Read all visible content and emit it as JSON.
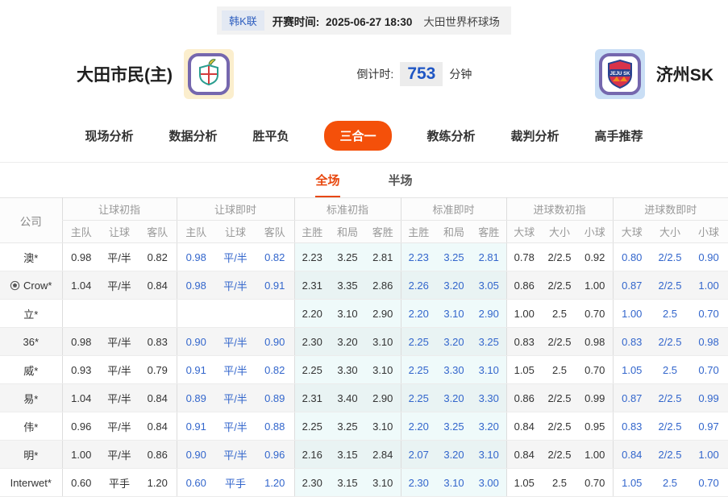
{
  "top_bar": {
    "league": "韩K联",
    "kickoff_label": "开赛时间:",
    "kickoff_time": "2025-06-27 18:30",
    "venue": "大田世界杯球场"
  },
  "match_header": {
    "home_team": "大田市民(主)",
    "away_team": "济州SK",
    "countdown_label": "倒计时:",
    "countdown_value": "753",
    "countdown_unit": "分钟"
  },
  "nav_tabs": [
    {
      "label": "现场分析",
      "active": false
    },
    {
      "label": "数据分析",
      "active": false
    },
    {
      "label": "胜平负",
      "active": false
    },
    {
      "label": "三合一",
      "active": true
    },
    {
      "label": "教练分析",
      "active": false
    },
    {
      "label": "裁判分析",
      "active": false
    },
    {
      "label": "高手推荐",
      "active": false
    }
  ],
  "period_tabs": [
    {
      "label": "全场",
      "active": true
    },
    {
      "label": "半场",
      "active": false
    }
  ],
  "odds_table": {
    "company_header": "公司",
    "groups": [
      {
        "label": "让球初指",
        "cols": [
          "主队",
          "让球",
          "客队"
        ],
        "live": false,
        "tint": false
      },
      {
        "label": "让球即时",
        "cols": [
          "主队",
          "让球",
          "客队"
        ],
        "live": true,
        "tint": false
      },
      {
        "label": "标准初指",
        "cols": [
          "主胜",
          "和局",
          "客胜"
        ],
        "live": false,
        "tint": true
      },
      {
        "label": "标准即时",
        "cols": [
          "主胜",
          "和局",
          "客胜"
        ],
        "live": true,
        "tint": true
      },
      {
        "label": "进球数初指",
        "cols": [
          "大球",
          "大小",
          "小球"
        ],
        "live": false,
        "tint": false
      },
      {
        "label": "进球数即时",
        "cols": [
          "大球",
          "大小",
          "小球"
        ],
        "live": true,
        "tint": false
      }
    ],
    "rows": [
      {
        "company": "澳*",
        "icon": false,
        "cells": [
          [
            "0.98",
            "平/半",
            "0.82"
          ],
          [
            "0.98",
            "平/半",
            "0.82"
          ],
          [
            "2.23",
            "3.25",
            "2.81"
          ],
          [
            "2.23",
            "3.25",
            "2.81"
          ],
          [
            "0.78",
            "2/2.5",
            "0.92"
          ],
          [
            "0.80",
            "2/2.5",
            "0.90"
          ]
        ]
      },
      {
        "company": "Crow*",
        "icon": true,
        "cells": [
          [
            "1.04",
            "平/半",
            "0.84"
          ],
          [
            "0.98",
            "平/半",
            "0.91"
          ],
          [
            "2.31",
            "3.35",
            "2.86"
          ],
          [
            "2.26",
            "3.20",
            "3.05"
          ],
          [
            "0.86",
            "2/2.5",
            "1.00"
          ],
          [
            "0.87",
            "2/2.5",
            "1.00"
          ]
        ]
      },
      {
        "company": "立*",
        "icon": false,
        "cells": [
          [
            "",
            "",
            ""
          ],
          [
            "",
            "",
            ""
          ],
          [
            "2.20",
            "3.10",
            "2.90"
          ],
          [
            "2.20",
            "3.10",
            "2.90"
          ],
          [
            "1.00",
            "2.5",
            "0.70"
          ],
          [
            "1.00",
            "2.5",
            "0.70"
          ]
        ]
      },
      {
        "company": "36*",
        "icon": false,
        "cells": [
          [
            "0.98",
            "平/半",
            "0.83"
          ],
          [
            "0.90",
            "平/半",
            "0.90"
          ],
          [
            "2.30",
            "3.20",
            "3.10"
          ],
          [
            "2.25",
            "3.20",
            "3.25"
          ],
          [
            "0.83",
            "2/2.5",
            "0.98"
          ],
          [
            "0.83",
            "2/2.5",
            "0.98"
          ]
        ]
      },
      {
        "company": "威*",
        "icon": false,
        "cells": [
          [
            "0.93",
            "平/半",
            "0.79"
          ],
          [
            "0.91",
            "平/半",
            "0.82"
          ],
          [
            "2.25",
            "3.30",
            "3.10"
          ],
          [
            "2.25",
            "3.30",
            "3.10"
          ],
          [
            "1.05",
            "2.5",
            "0.70"
          ],
          [
            "1.05",
            "2.5",
            "0.70"
          ]
        ]
      },
      {
        "company": "易*",
        "icon": false,
        "cells": [
          [
            "1.04",
            "平/半",
            "0.84"
          ],
          [
            "0.89",
            "平/半",
            "0.89"
          ],
          [
            "2.31",
            "3.40",
            "2.90"
          ],
          [
            "2.25",
            "3.20",
            "3.30"
          ],
          [
            "0.86",
            "2/2.5",
            "0.99"
          ],
          [
            "0.87",
            "2/2.5",
            "0.99"
          ]
        ]
      },
      {
        "company": "伟*",
        "icon": false,
        "cells": [
          [
            "0.96",
            "平/半",
            "0.84"
          ],
          [
            "0.91",
            "平/半",
            "0.88"
          ],
          [
            "2.25",
            "3.25",
            "3.10"
          ],
          [
            "2.20",
            "3.25",
            "3.20"
          ],
          [
            "0.84",
            "2/2.5",
            "0.95"
          ],
          [
            "0.83",
            "2/2.5",
            "0.97"
          ]
        ]
      },
      {
        "company": "明*",
        "icon": false,
        "cells": [
          [
            "1.00",
            "平/半",
            "0.86"
          ],
          [
            "0.90",
            "平/半",
            "0.96"
          ],
          [
            "2.16",
            "3.15",
            "2.84"
          ],
          [
            "2.07",
            "3.20",
            "3.10"
          ],
          [
            "0.84",
            "2/2.5",
            "1.00"
          ],
          [
            "0.84",
            "2/2.5",
            "1.00"
          ]
        ]
      },
      {
        "company": "Interwet*",
        "icon": false,
        "cells": [
          [
            "0.60",
            "平手",
            "1.20"
          ],
          [
            "0.60",
            "平手",
            "1.20"
          ],
          [
            "2.30",
            "3.15",
            "3.10"
          ],
          [
            "2.30",
            "3.10",
            "3.00"
          ],
          [
            "1.05",
            "2.5",
            "0.70"
          ],
          [
            "1.05",
            "2.5",
            "0.70"
          ]
        ]
      }
    ]
  },
  "colors": {
    "accent_orange": "#f4500a",
    "active_red": "#e8470e",
    "live_blue": "#3366cc",
    "tint_cyan": "#effafa",
    "countdown_blue": "#1f56c4"
  }
}
